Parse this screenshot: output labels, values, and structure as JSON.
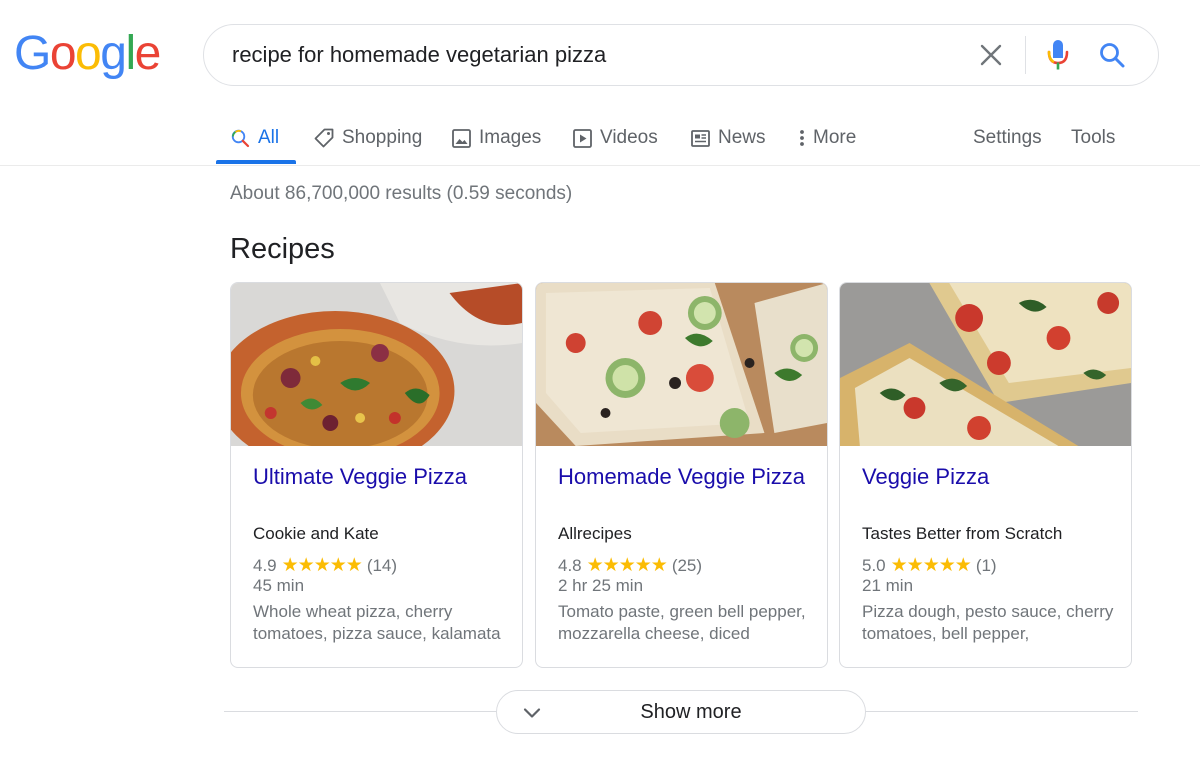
{
  "logo": {
    "letters": [
      "G",
      "o",
      "o",
      "g",
      "l",
      "e"
    ]
  },
  "colors": {
    "blue": "#4285f4",
    "red": "#ea4335",
    "yellow": "#fbbc05",
    "green": "#34a853",
    "link": "#1a0dab",
    "active_tab": "#1a73e8",
    "star": "#fbbc04"
  },
  "search": {
    "query": "recipe for homemade vegetarian pizza",
    "icons": [
      "close-icon",
      "mic-icon",
      "search-icon"
    ]
  },
  "nav": {
    "tabs": [
      {
        "label": "All",
        "icon": "search-icon",
        "active": true
      },
      {
        "label": "Shopping",
        "icon": "tag-icon"
      },
      {
        "label": "Images",
        "icon": "image-icon"
      },
      {
        "label": "Videos",
        "icon": "play-icon"
      },
      {
        "label": "News",
        "icon": "news-icon"
      },
      {
        "label": "More",
        "icon": "more-vert-icon"
      }
    ],
    "settings": "Settings",
    "tools": "Tools"
  },
  "stats": "About 86,700,000 results (0.59 seconds)",
  "recipes": {
    "heading": "Recipes",
    "cards": [
      {
        "title": "Ultimate Veggie Pizza",
        "source": "Cookie and Kate",
        "rating": "4.9",
        "rating_value": 4.9,
        "stars": "★★★★★",
        "reviews": "(14)",
        "time": "45 min",
        "ingredients": "Whole wheat pizza, cherry tomatoes, pizza sauce, kalamata"
      },
      {
        "title": "Homemade Veggie Pizza",
        "source": "Allrecipes",
        "rating": "4.8",
        "rating_value": 4.8,
        "stars": "★★★★★",
        "reviews": "(25)",
        "time": "2 hr 25 min",
        "ingredients": "Tomato paste, green bell pepper, mozzarella cheese, diced"
      },
      {
        "title": "Veggie Pizza",
        "source": "Tastes Better from Scratch",
        "rating": "5.0",
        "rating_value": 5.0,
        "stars": "★★★★★",
        "reviews": "(1)",
        "time": "21 min",
        "ingredients": "Pizza dough, pesto sauce, cherry tomatoes, bell pepper,"
      }
    ]
  },
  "show_more": {
    "label": "Show more"
  }
}
